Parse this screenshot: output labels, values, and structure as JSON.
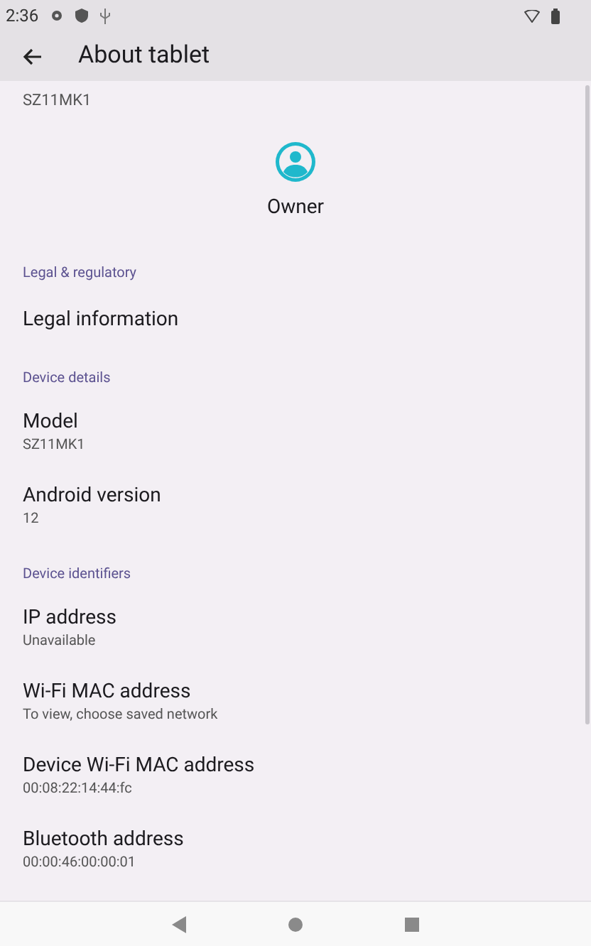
{
  "status_bar": {
    "time": "2:36"
  },
  "app_bar": {
    "title": "About tablet"
  },
  "device_name_value": "SZ11MK1",
  "owner": {
    "name": "Owner"
  },
  "sections": [
    {
      "header": "Legal & regulatory",
      "items": [
        {
          "title": "Legal information"
        }
      ]
    },
    {
      "header": "Device details",
      "items": [
        {
          "title": "Model",
          "summary": "SZ11MK1"
        },
        {
          "title": "Android version",
          "summary": "12"
        }
      ]
    },
    {
      "header": "Device identifiers",
      "items": [
        {
          "title": "IP address",
          "summary": "Unavailable"
        },
        {
          "title": "Wi-Fi MAC address",
          "summary": "To view, choose saved network"
        },
        {
          "title": "Device Wi-Fi MAC address",
          "summary": "00:08:22:14:44:fc"
        },
        {
          "title": "Bluetooth address",
          "summary": "00:00:46:00:00:01"
        }
      ]
    }
  ]
}
